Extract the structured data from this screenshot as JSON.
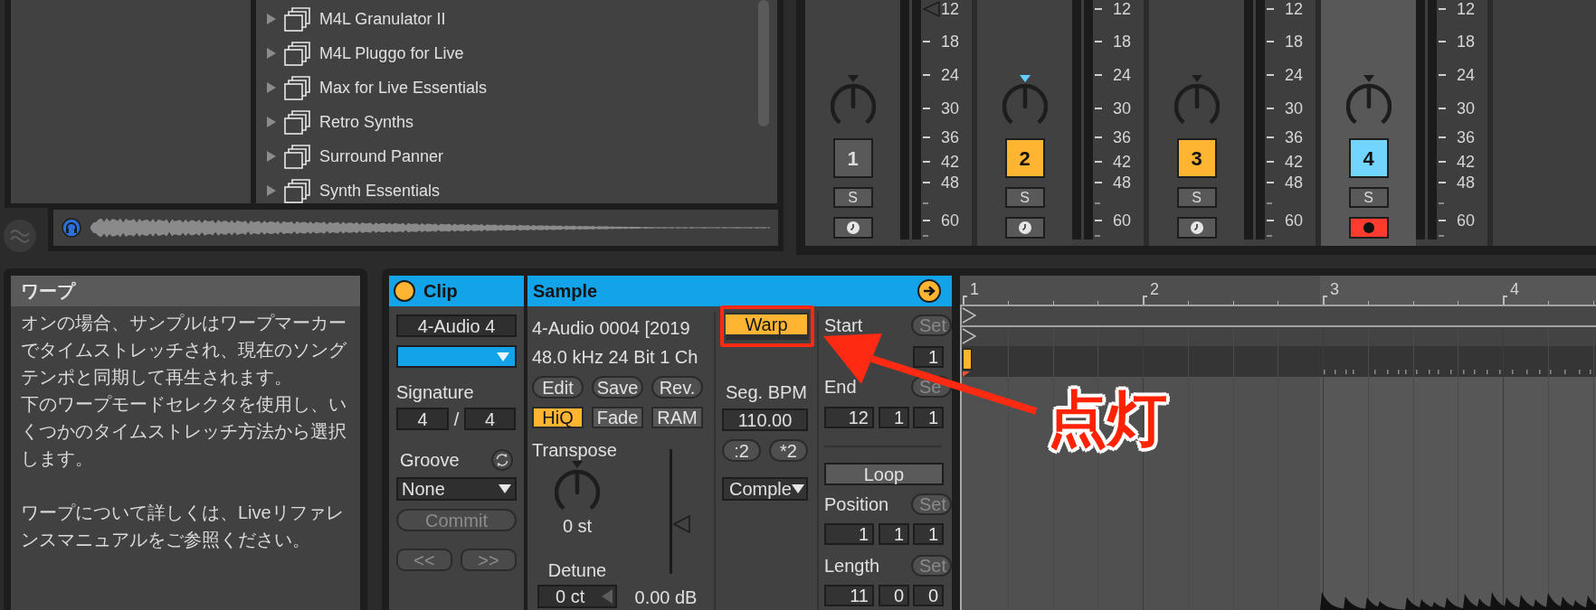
{
  "browser": {
    "items": [
      {
        "label": "M4L Granulator II",
        "expanded": false
      },
      {
        "label": "M4L Pluggo for Live",
        "expanded": false
      },
      {
        "label": "Max for Live Essentials",
        "expanded": false
      },
      {
        "label": "Retro Synths",
        "expanded": false
      },
      {
        "label": "Surround Panner",
        "expanded": false
      },
      {
        "label": "Synth Essentials",
        "expanded": false
      }
    ]
  },
  "mixer": {
    "channels": [
      {
        "number": "1",
        "active": false,
        "selected": false,
        "pan_focused": false,
        "fader_marker": true,
        "solo_label": "S",
        "soloed": false,
        "armed": false,
        "scale": [
          "12",
          "18",
          "24",
          "30",
          "36",
          "42",
          "48",
          "60"
        ]
      },
      {
        "number": "2",
        "active": true,
        "selected": false,
        "pan_focused": true,
        "fader_marker": false,
        "solo_label": "S",
        "soloed": false,
        "armed": false,
        "scale": [
          "12",
          "18",
          "24",
          "30",
          "36",
          "42",
          "48",
          "60"
        ]
      },
      {
        "number": "3",
        "active": true,
        "selected": false,
        "pan_focused": false,
        "fader_marker": false,
        "solo_label": "S",
        "soloed": false,
        "armed": false,
        "scale": [
          "12",
          "18",
          "24",
          "30",
          "36",
          "42",
          "48",
          "60"
        ]
      },
      {
        "number": "4",
        "active": true,
        "selected": true,
        "pan_focused": false,
        "fader_marker": false,
        "solo_label": "S",
        "soloed": false,
        "armed": true,
        "scale": [
          "12",
          "18",
          "24",
          "30",
          "36",
          "42",
          "48",
          "60"
        ]
      }
    ]
  },
  "info": {
    "title": "ワープ",
    "sections": [
      [
        "オンの場合、サンプルはワープマーカーでタイムストレッチされ、現在のソングテンポと同期して再生されます。",
        "下のワープモードセレクタを使用し、いくつかのタイムストレッチ方法から選択します。"
      ],
      [
        "ワープについて詳しくは、Liveリファレンスマニュアルをご参照ください。"
      ]
    ]
  },
  "clip": {
    "title": "Clip",
    "active": true,
    "name": "4-Audio 4",
    "color": "#12a3e9",
    "signature_label": "Signature",
    "signature": [
      "4",
      "4"
    ],
    "signature_separator": "/",
    "groove_label": "Groove",
    "groove": "None",
    "commit": {
      "label": "Commit",
      "disabled": true
    },
    "nudge": [
      {
        "label": "<<",
        "disabled": true
      },
      {
        "label": ">>",
        "disabled": true
      }
    ]
  },
  "sample": {
    "title": "Sample",
    "file": "4-Audio 0004 [2019",
    "format": "48.0 kHz 24 Bit 1 Ch",
    "actions": [
      {
        "label": "Edit"
      },
      {
        "label": "Save"
      },
      {
        "label": "Rev."
      }
    ],
    "toggles": [
      {
        "label": "HiQ",
        "on": true
      },
      {
        "label": "Fade",
        "on": false
      },
      {
        "label": "RAM",
        "on": false
      }
    ],
    "transpose": {
      "label": "Transpose",
      "value": "0 st"
    },
    "gain": {
      "level": 0.4,
      "value": "0.00 dB"
    },
    "detune": {
      "label": "Detune",
      "value": "0 ct"
    },
    "warp": {
      "label": "Warp",
      "on": true
    },
    "seg_bpm": {
      "label": "Seg. BPM",
      "value": "110.00"
    },
    "tempo_buttons": [
      {
        "label": ":2"
      },
      {
        "label": "*2"
      }
    ],
    "warp_mode": "Comple",
    "clip_markers": [
      {
        "label": "Start",
        "set": "Set",
        "set_disabled": true,
        "values": [
          "1"
        ]
      },
      {
        "label": "End",
        "set": "Se",
        "set_disabled": true,
        "values": [
          "12",
          "1",
          "1"
        ]
      }
    ],
    "loop": {
      "label": "Loop",
      "on": false
    },
    "loop_markers": [
      {
        "label": "Position",
        "set": "Set",
        "set_disabled": true,
        "values": [
          "1",
          "1",
          "1"
        ]
      },
      {
        "label": "Length",
        "set": "Set",
        "set_disabled": true,
        "values": [
          "11",
          "0",
          "0"
        ]
      }
    ]
  },
  "timeline": {
    "ruler": [
      "1",
      "2",
      "3",
      "4"
    ]
  },
  "annotation": {
    "text": "点灯"
  }
}
